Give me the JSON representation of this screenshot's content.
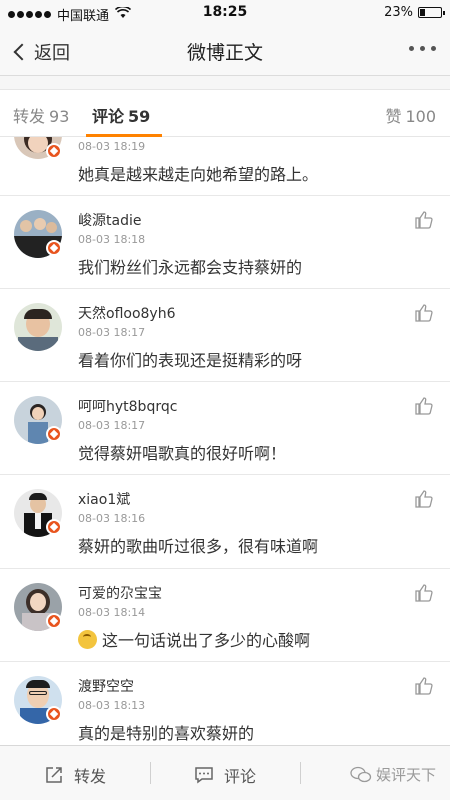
{
  "status_bar": {
    "carrier": "中国联通",
    "time": "18:25",
    "battery": "23%",
    "battery_level": 0.23
  },
  "nav": {
    "back_label": "返回",
    "title": "微博正文"
  },
  "tabs": {
    "repost": {
      "label": "转发",
      "count": "93"
    },
    "comment": {
      "label": "评论",
      "count": "59"
    },
    "like": {
      "label": "赞",
      "count": "100"
    }
  },
  "comments": [
    {
      "user": "",
      "time": "08-03 18:19",
      "text": "她真是越来越走向她希望的路上。"
    },
    {
      "user": "峻源tadie",
      "time": "08-03 18:18",
      "text": "我们粉丝们永远都会支持蔡妍的"
    },
    {
      "user": "天然ofloo8yh6",
      "time": "08-03 18:17",
      "text": "看着你们的表现还是挺精彩的呀"
    },
    {
      "user": "呵呵hyt8bqrqc",
      "time": "08-03 18:17",
      "text": "觉得蔡妍唱歌真的很好听啊！"
    },
    {
      "user": "xiao1斌",
      "time": "08-03 18:16",
      "text": "蔡妍的歌曲听过很多，很有味道啊"
    },
    {
      "user": "可爱的尕宝宝",
      "time": "08-03 18:14",
      "text": "这一句话说出了多少的心酸啊"
    },
    {
      "user": "渡野空空",
      "time": "08-03 18:13",
      "text": "真的是特别的喜欢蔡妍的"
    }
  ],
  "bottom_bar": {
    "repost_label": "转发",
    "comment_label": "评论",
    "watermark": "娱评天下"
  }
}
